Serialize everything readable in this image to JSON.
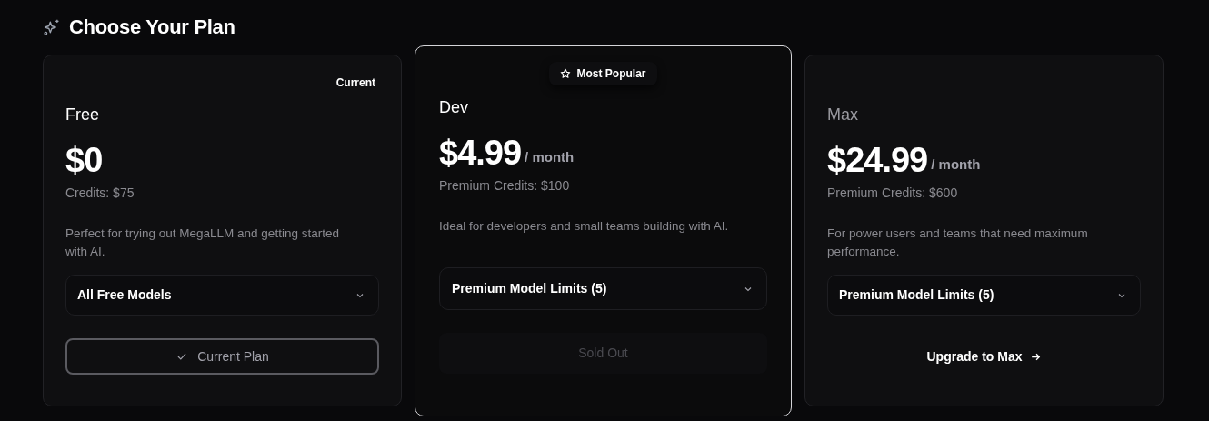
{
  "title": "Choose Your Plan",
  "plans": [
    {
      "name": "Free",
      "name_dimmed": false,
      "highlighted": false,
      "badge": {
        "kind": "current",
        "label": "Current"
      },
      "price": "$0",
      "credits": "Credits: $75",
      "description": "Perfect for trying out MegaLLM and getting started with AI.",
      "features_label": "All Free Models",
      "action": {
        "kind": "current",
        "label": "Current Plan"
      }
    },
    {
      "name": "Dev",
      "name_dimmed": false,
      "highlighted": true,
      "badge": {
        "kind": "popular",
        "label": "Most Popular"
      },
      "price": "$4.99",
      "period": "/ month",
      "credits": "Premium Credits: $100",
      "description": "Ideal for developers and small teams building with AI.",
      "features_label": "Premium Model Limits (5)",
      "action": {
        "kind": "disabled",
        "label": "Sold Out"
      }
    },
    {
      "name": "Max",
      "name_dimmed": true,
      "highlighted": false,
      "price": "$24.99",
      "period": "/ month",
      "credits": "Premium Credits: $600",
      "description": "For power users and teams that need maximum performance.",
      "features_label": "Premium Model Limits (5)",
      "action": {
        "kind": "upgrade",
        "label": "Upgrade to Max"
      }
    }
  ]
}
